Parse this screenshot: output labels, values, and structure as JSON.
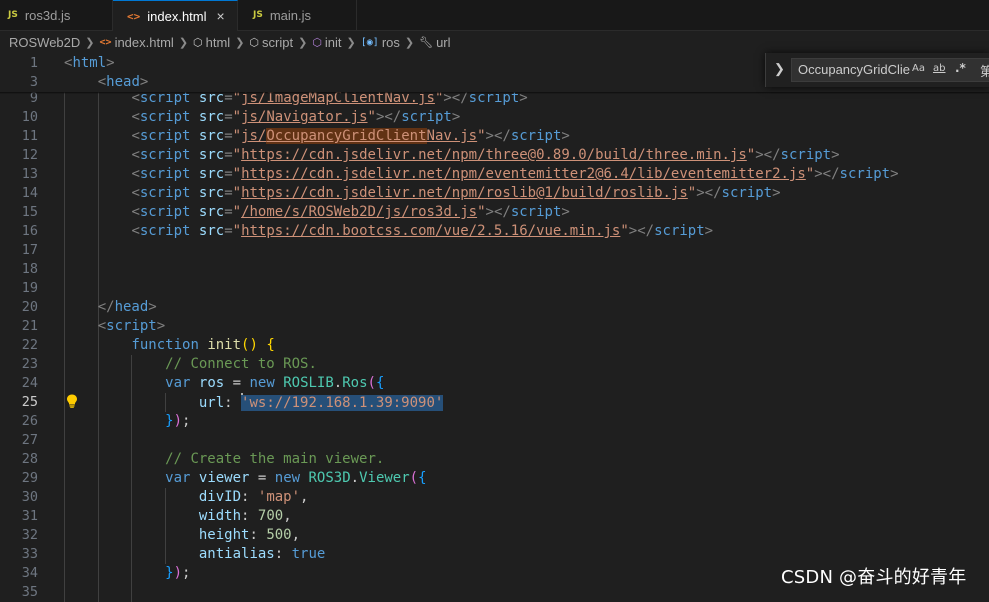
{
  "tabs": [
    {
      "icon": "JS",
      "label": "ros3d.js",
      "active": false
    },
    {
      "icon": "<>",
      "label": "index.html",
      "active": true,
      "close": "×"
    },
    {
      "icon": "JS",
      "label": "main.js",
      "active": false
    }
  ],
  "breadcrumb": [
    "ROSWeb2D",
    "index.html",
    "html",
    "script",
    "init",
    "ros",
    "url"
  ],
  "find": {
    "query": "OccupancyGridClie",
    "opt_case": "Aa",
    "opt_word": "ab",
    "opt_regex": ".*",
    "count": "第"
  },
  "editor": {
    "current_line": "25",
    "sticky_lines": [
      {
        "num": "1",
        "tokens": [
          {
            "t": "<",
            "c": "pun"
          },
          {
            "t": "html",
            "c": "tag"
          },
          {
            "t": ">",
            "c": "pun"
          }
        ]
      },
      {
        "num": "3",
        "indent": 4,
        "tokens": [
          {
            "t": "<",
            "c": "pun"
          },
          {
            "t": "head",
            "c": "tag"
          },
          {
            "t": ">",
            "c": "pun"
          }
        ]
      }
    ],
    "lines": [
      {
        "num": "9",
        "indent": 8,
        "tokens": [
          {
            "t": "<",
            "c": "pun"
          },
          {
            "t": "script",
            "c": "tag"
          },
          {
            "t": " "
          },
          {
            "t": "src",
            "c": "attr"
          },
          {
            "t": "=",
            "c": "pun"
          },
          {
            "t": "\"",
            "c": "str"
          },
          {
            "t": "js/ImageMapClientNav.js",
            "c": "str link"
          },
          {
            "t": "\"",
            "c": "str"
          },
          {
            "t": "></",
            "c": "pun"
          },
          {
            "t": "script",
            "c": "tag"
          },
          {
            "t": ">",
            "c": "pun"
          }
        ]
      },
      {
        "num": "10",
        "indent": 8,
        "tokens": [
          {
            "t": "<",
            "c": "pun"
          },
          {
            "t": "script",
            "c": "tag"
          },
          {
            "t": " "
          },
          {
            "t": "src",
            "c": "attr"
          },
          {
            "t": "=",
            "c": "pun"
          },
          {
            "t": "\"",
            "c": "str"
          },
          {
            "t": "js/Navigator.js",
            "c": "str link"
          },
          {
            "t": "\"",
            "c": "str"
          },
          {
            "t": "></",
            "c": "pun"
          },
          {
            "t": "script",
            "c": "tag"
          },
          {
            "t": ">",
            "c": "pun"
          }
        ]
      },
      {
        "num": "11",
        "indent": 8,
        "tokens": [
          {
            "t": "<",
            "c": "pun"
          },
          {
            "t": "script",
            "c": "tag"
          },
          {
            "t": " "
          },
          {
            "t": "src",
            "c": "attr"
          },
          {
            "t": "=",
            "c": "pun"
          },
          {
            "t": "\"",
            "c": "str"
          },
          {
            "t": "js/",
            "c": "str link"
          },
          {
            "t": "OccupancyGridClient",
            "c": "str link find"
          },
          {
            "t": "Nav.js",
            "c": "str link"
          },
          {
            "t": "\"",
            "c": "str"
          },
          {
            "t": "></",
            "c": "pun"
          },
          {
            "t": "script",
            "c": "tag"
          },
          {
            "t": ">",
            "c": "pun"
          }
        ]
      },
      {
        "num": "12",
        "indent": 8,
        "tokens": [
          {
            "t": "<",
            "c": "pun"
          },
          {
            "t": "script",
            "c": "tag"
          },
          {
            "t": " "
          },
          {
            "t": "src",
            "c": "attr"
          },
          {
            "t": "=",
            "c": "pun"
          },
          {
            "t": "\"",
            "c": "str"
          },
          {
            "t": "https://cdn.jsdelivr.net/npm/three@0.89.0/build/three.min.js",
            "c": "str link"
          },
          {
            "t": "\"",
            "c": "str"
          },
          {
            "t": "></",
            "c": "pun"
          },
          {
            "t": "script",
            "c": "tag"
          },
          {
            "t": ">",
            "c": "pun"
          }
        ]
      },
      {
        "num": "13",
        "indent": 8,
        "tokens": [
          {
            "t": "<",
            "c": "pun"
          },
          {
            "t": "script",
            "c": "tag"
          },
          {
            "t": " "
          },
          {
            "t": "src",
            "c": "attr"
          },
          {
            "t": "=",
            "c": "pun"
          },
          {
            "t": "\"",
            "c": "str"
          },
          {
            "t": "https://cdn.jsdelivr.net/npm/eventemitter2@6.4/lib/eventemitter2.js",
            "c": "str link"
          },
          {
            "t": "\"",
            "c": "str"
          },
          {
            "t": "></",
            "c": "pun"
          },
          {
            "t": "script",
            "c": "tag"
          },
          {
            "t": ">",
            "c": "pun"
          }
        ]
      },
      {
        "num": "14",
        "indent": 8,
        "tokens": [
          {
            "t": "<",
            "c": "pun"
          },
          {
            "t": "script",
            "c": "tag"
          },
          {
            "t": " "
          },
          {
            "t": "src",
            "c": "attr"
          },
          {
            "t": "=",
            "c": "pun"
          },
          {
            "t": "\"",
            "c": "str"
          },
          {
            "t": "https://cdn.jsdelivr.net/npm/roslib@1/build/roslib.js",
            "c": "str link"
          },
          {
            "t": "\"",
            "c": "str"
          },
          {
            "t": "></",
            "c": "pun"
          },
          {
            "t": "script",
            "c": "tag"
          },
          {
            "t": ">",
            "c": "pun"
          }
        ]
      },
      {
        "num": "15",
        "indent": 8,
        "tokens": [
          {
            "t": "<",
            "c": "pun"
          },
          {
            "t": "script",
            "c": "tag"
          },
          {
            "t": " "
          },
          {
            "t": "src",
            "c": "attr"
          },
          {
            "t": "=",
            "c": "pun"
          },
          {
            "t": "\"",
            "c": "str"
          },
          {
            "t": "/home/s/ROSWeb2D/js/ros3d.js",
            "c": "str link"
          },
          {
            "t": "\"",
            "c": "str"
          },
          {
            "t": "></",
            "c": "pun"
          },
          {
            "t": "script",
            "c": "tag"
          },
          {
            "t": ">",
            "c": "pun"
          }
        ]
      },
      {
        "num": "16",
        "indent": 8,
        "tokens": [
          {
            "t": "<",
            "c": "pun"
          },
          {
            "t": "script",
            "c": "tag"
          },
          {
            "t": " "
          },
          {
            "t": "src",
            "c": "attr"
          },
          {
            "t": "=",
            "c": "pun"
          },
          {
            "t": "\"",
            "c": "str"
          },
          {
            "t": "https://cdn.bootcss.com/vue/2.5.16/vue.min.js",
            "c": "str link"
          },
          {
            "t": "\"",
            "c": "str"
          },
          {
            "t": "></",
            "c": "pun"
          },
          {
            "t": "script",
            "c": "tag"
          },
          {
            "t": ">",
            "c": "pun"
          }
        ]
      },
      {
        "num": "17",
        "indent": 0,
        "tokens": []
      },
      {
        "num": "18",
        "indent": 0,
        "tokens": []
      },
      {
        "num": "19",
        "indent": 0,
        "tokens": []
      },
      {
        "num": "20",
        "indent": 4,
        "tokens": [
          {
            "t": "</",
            "c": "pun"
          },
          {
            "t": "head",
            "c": "tag"
          },
          {
            "t": ">",
            "c": "pun"
          }
        ]
      },
      {
        "num": "21",
        "indent": 4,
        "tokens": [
          {
            "t": "<",
            "c": "pun"
          },
          {
            "t": "script",
            "c": "tag"
          },
          {
            "t": ">",
            "c": "pun"
          }
        ]
      },
      {
        "num": "22",
        "indent": 8,
        "tokens": [
          {
            "t": "function",
            "c": "kw"
          },
          {
            "t": " "
          },
          {
            "t": "init",
            "c": "fn"
          },
          {
            "t": "()",
            "c": "br1"
          },
          {
            "t": " "
          },
          {
            "t": "{",
            "c": "br1"
          }
        ]
      },
      {
        "num": "23",
        "indent": 12,
        "tokens": [
          {
            "t": "// Connect to ROS.",
            "c": "cmt"
          }
        ]
      },
      {
        "num": "24",
        "indent": 12,
        "tokens": [
          {
            "t": "var",
            "c": "kw"
          },
          {
            "t": " "
          },
          {
            "t": "ros",
            "c": "var"
          },
          {
            "t": " = "
          },
          {
            "t": "new",
            "c": "kw"
          },
          {
            "t": " "
          },
          {
            "t": "ROSLIB",
            "c": "cls"
          },
          {
            "t": "."
          },
          {
            "t": "Ros",
            "c": "cls"
          },
          {
            "t": "(",
            "c": "br2"
          },
          {
            "t": "{",
            "c": "br3"
          }
        ]
      },
      {
        "num": "25",
        "indent": 16,
        "tokens": [
          {
            "t": "url",
            "c": "var"
          },
          {
            "t": ": "
          },
          {
            "t": "",
            "c": "cursor"
          },
          {
            "t": "'ws://192.168.1.39:9090'",
            "c": "str sel"
          }
        ]
      },
      {
        "num": "26",
        "indent": 12,
        "tokens": [
          {
            "t": "}",
            "c": "br3"
          },
          {
            "t": ")",
            "c": "br2"
          },
          {
            "t": ";"
          }
        ]
      },
      {
        "num": "27",
        "indent": 0,
        "tokens": []
      },
      {
        "num": "28",
        "indent": 12,
        "tokens": [
          {
            "t": "// Create the main viewer.",
            "c": "cmt"
          }
        ]
      },
      {
        "num": "29",
        "indent": 12,
        "tokens": [
          {
            "t": "var",
            "c": "kw"
          },
          {
            "t": " "
          },
          {
            "t": "viewer",
            "c": "var"
          },
          {
            "t": " = "
          },
          {
            "t": "new",
            "c": "kw"
          },
          {
            "t": " "
          },
          {
            "t": "ROS3D",
            "c": "cls"
          },
          {
            "t": "."
          },
          {
            "t": "Viewer",
            "c": "cls"
          },
          {
            "t": "(",
            "c": "br2"
          },
          {
            "t": "{",
            "c": "br3"
          }
        ]
      },
      {
        "num": "30",
        "indent": 16,
        "tokens": [
          {
            "t": "divID",
            "c": "var"
          },
          {
            "t": ": "
          },
          {
            "t": "'map'",
            "c": "str"
          },
          {
            "t": ","
          }
        ]
      },
      {
        "num": "31",
        "indent": 16,
        "tokens": [
          {
            "t": "width",
            "c": "var"
          },
          {
            "t": ": "
          },
          {
            "t": "700",
            "c": "num"
          },
          {
            "t": ","
          }
        ]
      },
      {
        "num": "32",
        "indent": 16,
        "tokens": [
          {
            "t": "height",
            "c": "var"
          },
          {
            "t": ": "
          },
          {
            "t": "500",
            "c": "num"
          },
          {
            "t": ","
          }
        ]
      },
      {
        "num": "33",
        "indent": 16,
        "tokens": [
          {
            "t": "antialias",
            "c": "var"
          },
          {
            "t": ": "
          },
          {
            "t": "true",
            "c": "kw"
          }
        ]
      },
      {
        "num": "34",
        "indent": 12,
        "tokens": [
          {
            "t": "}",
            "c": "br3"
          },
          {
            "t": ")",
            "c": "br2"
          },
          {
            "t": ";"
          }
        ]
      },
      {
        "num": "35",
        "indent": 0,
        "tokens": []
      }
    ]
  },
  "watermark": "CSDN @奋斗的好青年"
}
